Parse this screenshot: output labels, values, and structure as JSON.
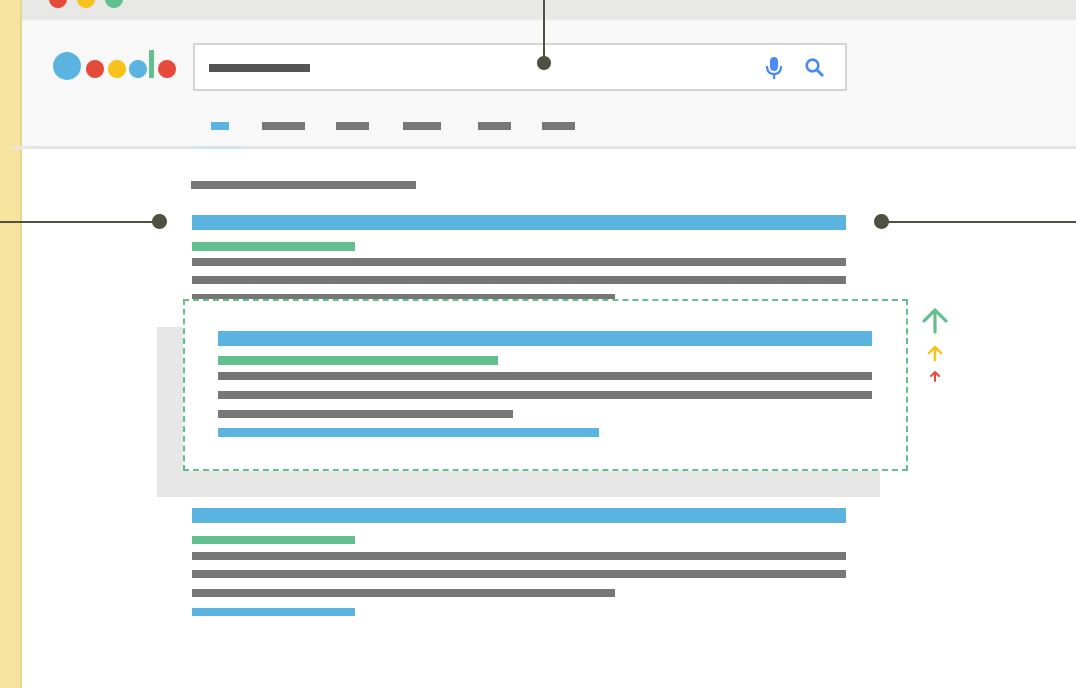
{
  "colors": {
    "accent_blue": "#5bb4e0",
    "accent_green": "#62c08f",
    "accent_yellow": "#f7c21b",
    "accent_red": "#e54a3b",
    "placeholder_gray": "#777777",
    "connector": "#4e5040",
    "window_chrome": "#e8e8e6",
    "header_bg": "#f8f8f8",
    "left_strip": "#f5e39e",
    "highlight_bg": "#e7e7e7"
  },
  "window_controls": [
    "close",
    "minimize",
    "maximize"
  ],
  "logo": {
    "dot_colors": [
      "#5bb4e0",
      "#e54a3b",
      "#f7c21b",
      "#5bb4e0",
      "#62c08f",
      "#e54a3b"
    ]
  },
  "search": {
    "masked_query": "true",
    "icons": [
      "microphone-icon",
      "search-icon"
    ]
  },
  "nav_tabs": {
    "count": 6,
    "active_index": 0
  },
  "results": {
    "count_placeholder": true,
    "result_count": 3,
    "highlighted_index": 1,
    "ranking_arrows": [
      "up-large-green",
      "up-medium-yellow",
      "up-small-red"
    ]
  }
}
